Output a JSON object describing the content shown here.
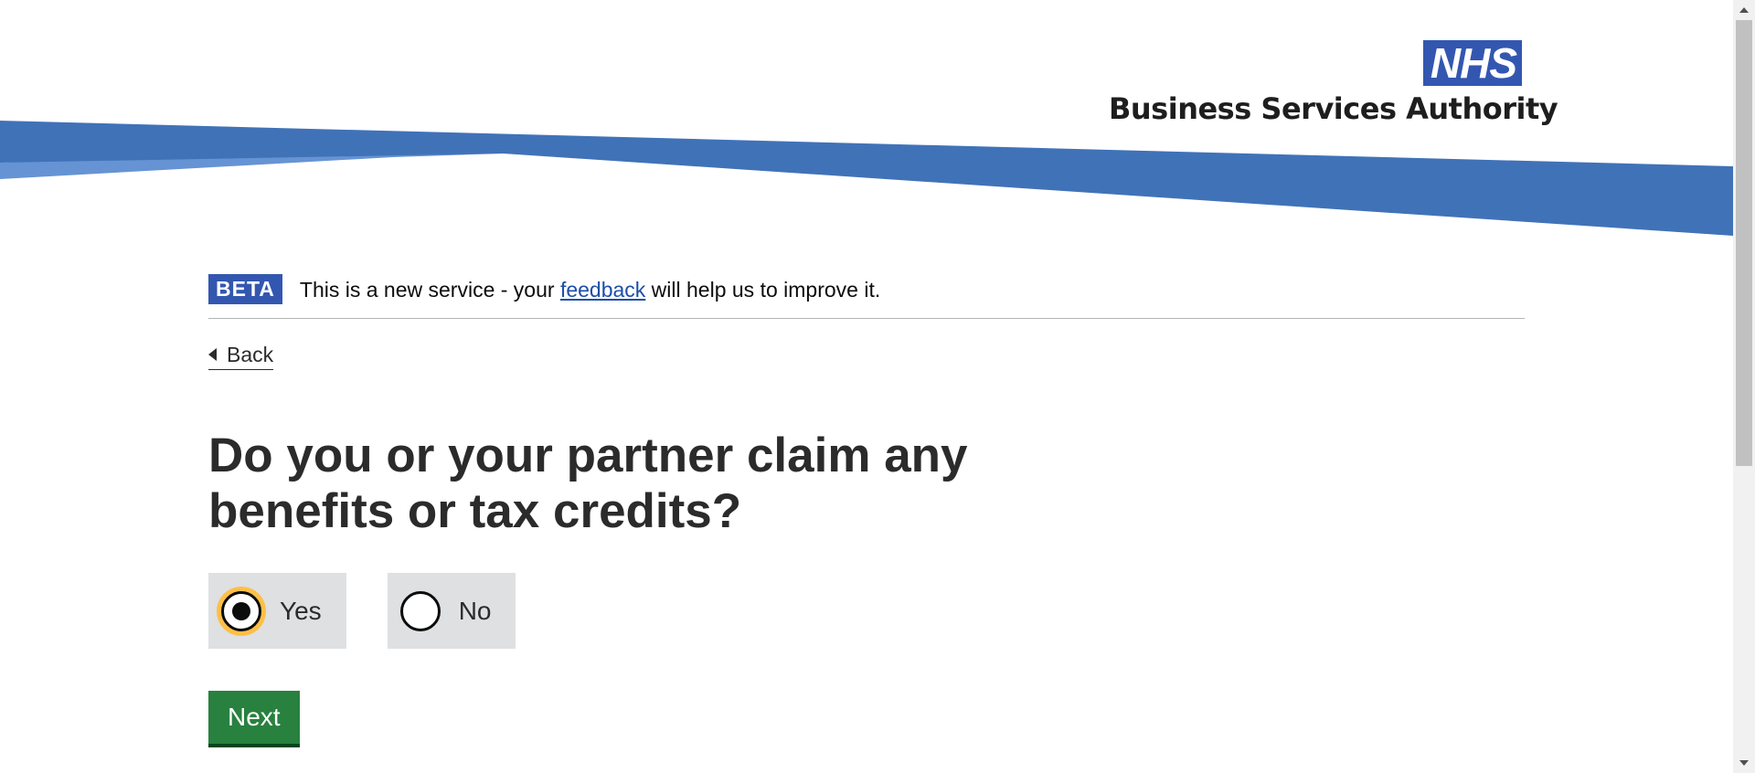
{
  "header": {
    "logo_mark": "NHS",
    "organisation": "Business Services Authority"
  },
  "phase_banner": {
    "tag": "BETA",
    "text_before": "This is a new service - your ",
    "link": "feedback",
    "text_after": " will help us to improve it."
  },
  "back_link": {
    "label": "Back"
  },
  "question": {
    "heading": "Do you or your partner claim any benefits or tax credits?",
    "options": [
      {
        "label": "Yes",
        "selected": true
      },
      {
        "label": "No",
        "selected": false
      }
    ]
  },
  "next_button": {
    "label": "Next"
  },
  "colors": {
    "brand_blue": "#3357b0",
    "swoosh_blue": "#4072b8",
    "swoosh_light": "#6693d3",
    "button_green": "#28813f",
    "focus_yellow": "#ffbf47"
  }
}
